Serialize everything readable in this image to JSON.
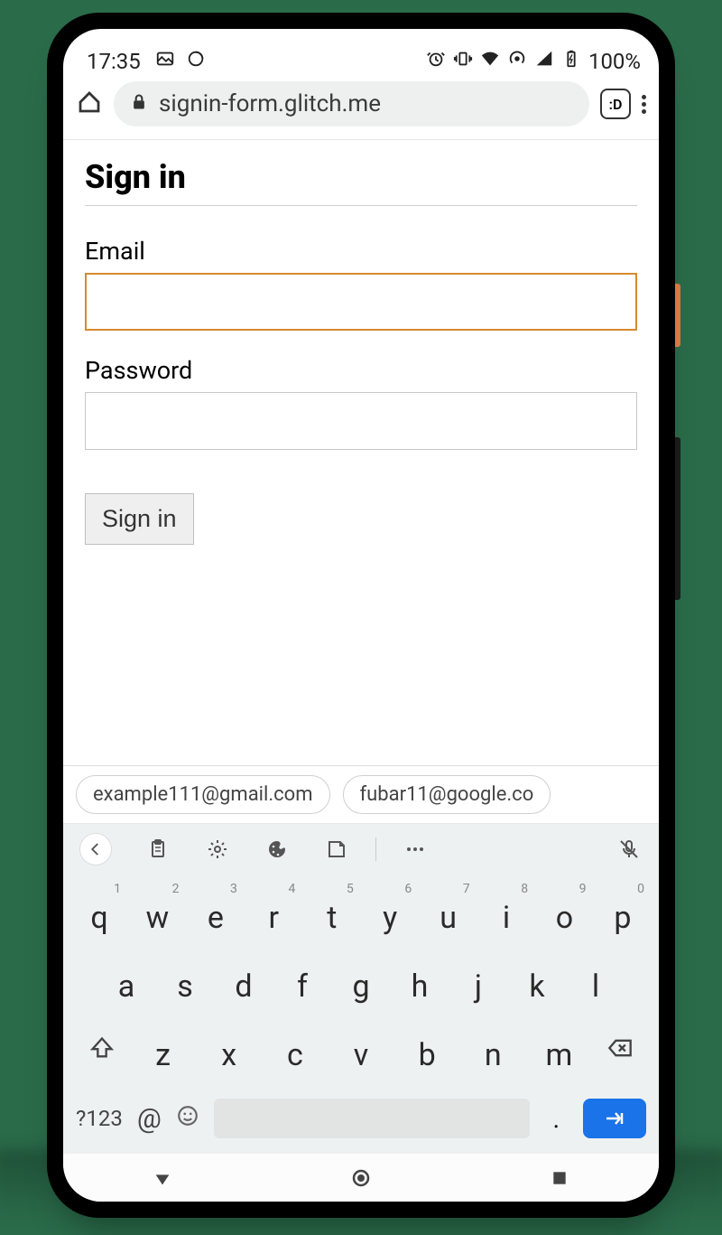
{
  "statusbar": {
    "time": "17:35",
    "battery": "100%"
  },
  "browser": {
    "url": "signin-form.glitch.me",
    "tab_badge": ":D"
  },
  "form": {
    "title": "Sign in",
    "email_label": "Email",
    "email_value": "",
    "password_label": "Password",
    "password_value": "",
    "submit_label": "Sign in"
  },
  "keyboard": {
    "suggestions": [
      "example111@gmail.com",
      "fubar11@google.co"
    ],
    "row1": [
      {
        "k": "q",
        "n": "1"
      },
      {
        "k": "w",
        "n": "2"
      },
      {
        "k": "e",
        "n": "3"
      },
      {
        "k": "r",
        "n": "4"
      },
      {
        "k": "t",
        "n": "5"
      },
      {
        "k": "y",
        "n": "6"
      },
      {
        "k": "u",
        "n": "7"
      },
      {
        "k": "i",
        "n": "8"
      },
      {
        "k": "o",
        "n": "9"
      },
      {
        "k": "p",
        "n": "0"
      }
    ],
    "row2": [
      "a",
      "s",
      "d",
      "f",
      "g",
      "h",
      "j",
      "k",
      "l"
    ],
    "row3": [
      "z",
      "x",
      "c",
      "v",
      "b",
      "n",
      "m"
    ],
    "symbols_label": "?123",
    "at_label": "@",
    "period_label": "."
  }
}
